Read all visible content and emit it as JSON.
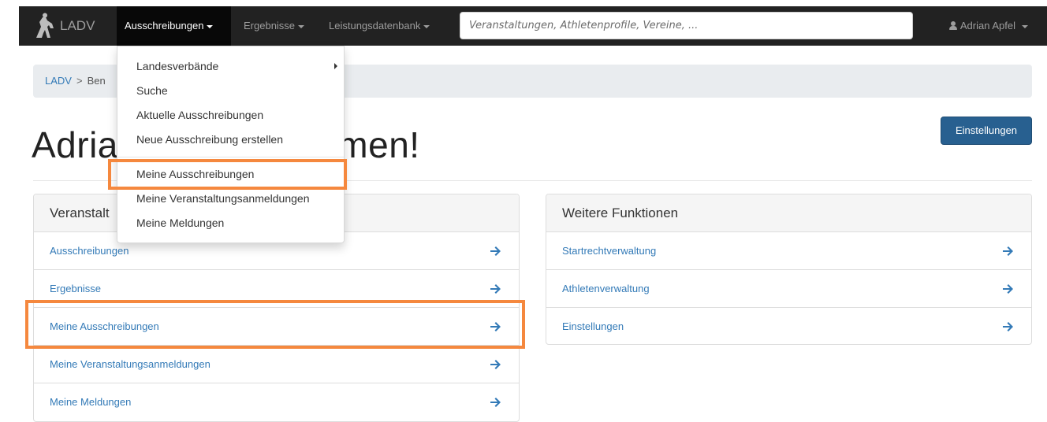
{
  "navbar": {
    "brand": "LADV",
    "items": [
      {
        "label": "Ausschreibungen",
        "active": true
      },
      {
        "label": "Ergebnisse",
        "active": false
      },
      {
        "label": "Leistungsdatenbank",
        "active": false
      }
    ],
    "search_placeholder": "Veranstaltungen, Athletenprofile, Vereine, ...",
    "user": "Adrian Apfel"
  },
  "breadcrumb": {
    "home": "LADV",
    "sep": ">",
    "current": "Ben"
  },
  "page": {
    "title": "Adria",
    "title_rest": "kommen!",
    "settings_button": "Einstellungen"
  },
  "dropdown": {
    "items": [
      "Landesverbände",
      "Suche",
      "Aktuelle Ausschreibungen",
      "Neue Ausschreibung erstellen"
    ],
    "items2": [
      "Meine Ausschreibungen",
      "Meine Veranstaltungsanmeldungen",
      "Meine Meldungen"
    ]
  },
  "panel_left": {
    "heading": "Veranstalt",
    "rows": [
      "Ausschreibungen",
      "Ergebnisse",
      "Meine Ausschreibungen",
      "Meine Veranstaltungsanmeldungen",
      "Meine Meldungen"
    ]
  },
  "panel_right": {
    "heading": "Weitere Funktionen",
    "rows": [
      "Startrechtverwaltung",
      "Athletenverwaltung",
      "Einstellungen"
    ]
  },
  "colors": {
    "navbar": "#222222",
    "link": "#337ab7",
    "primary_button": "#286090",
    "highlight": "#f5883e"
  }
}
